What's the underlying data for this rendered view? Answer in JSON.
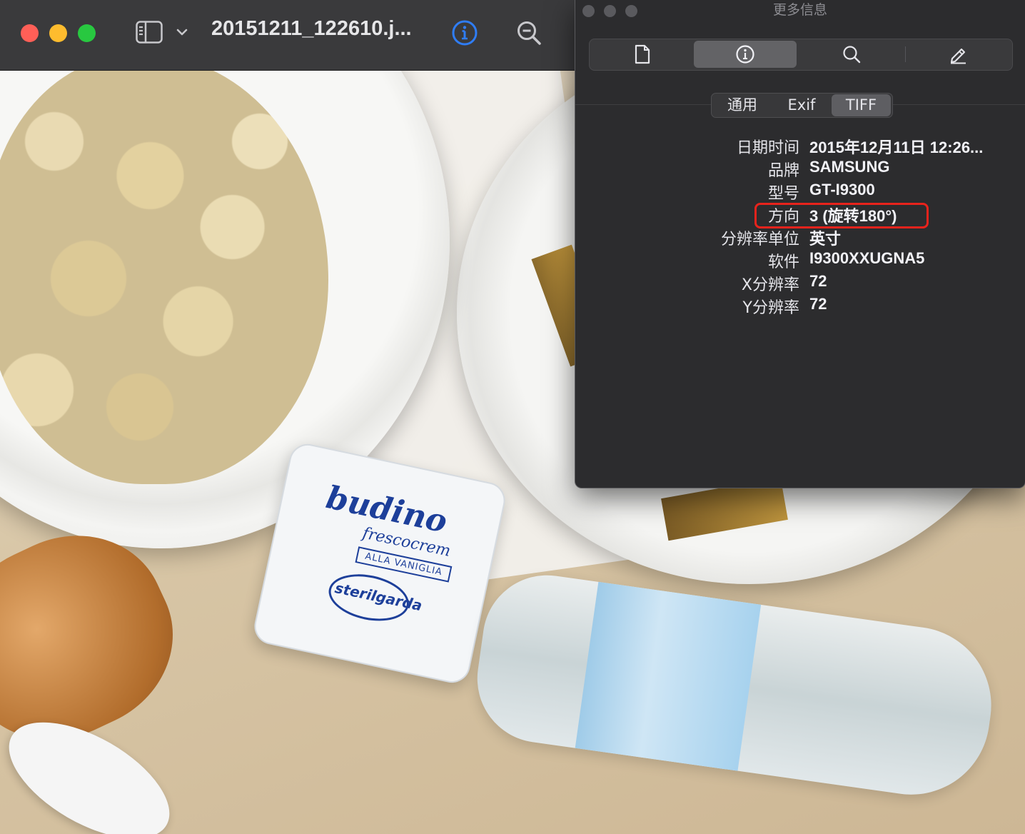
{
  "window": {
    "document_title": "20151211_122610.j...",
    "icons": [
      "sidebar-toggle-icon",
      "chevron-down-icon",
      "info-icon",
      "zoom-out-icon"
    ]
  },
  "photo": {
    "cup_brand": "budino",
    "cup_subtitle": "frescocrem",
    "cup_tag": "ALLA VANIGLIA",
    "cup_logo": "sterilgarda"
  },
  "inspector": {
    "title": "更多信息",
    "toolbar": [
      {
        "icon": "document-icon"
      },
      {
        "icon": "info-icon",
        "active": true
      },
      {
        "icon": "search-icon"
      },
      {
        "icon": "pencil-icon"
      }
    ],
    "tabs": [
      {
        "label": "通用"
      },
      {
        "label": "Exif"
      },
      {
        "label": "TIFF",
        "active": true
      }
    ],
    "rows": [
      {
        "key": "日期时间",
        "value": "2015年12月11日 12:26..."
      },
      {
        "key": "品牌",
        "value": "SAMSUNG"
      },
      {
        "key": "型号",
        "value": "GT-I9300"
      },
      {
        "key": "方向",
        "value": "3 (旋转180°)"
      },
      {
        "key": "分辨率单位",
        "value": "英寸"
      },
      {
        "key": "软件",
        "value": "I9300XXUGNA5"
      },
      {
        "key": "X分辨率",
        "value": "72"
      },
      {
        "key": "Y分辨率",
        "value": "72"
      }
    ],
    "highlight_color": "#e8231c"
  }
}
